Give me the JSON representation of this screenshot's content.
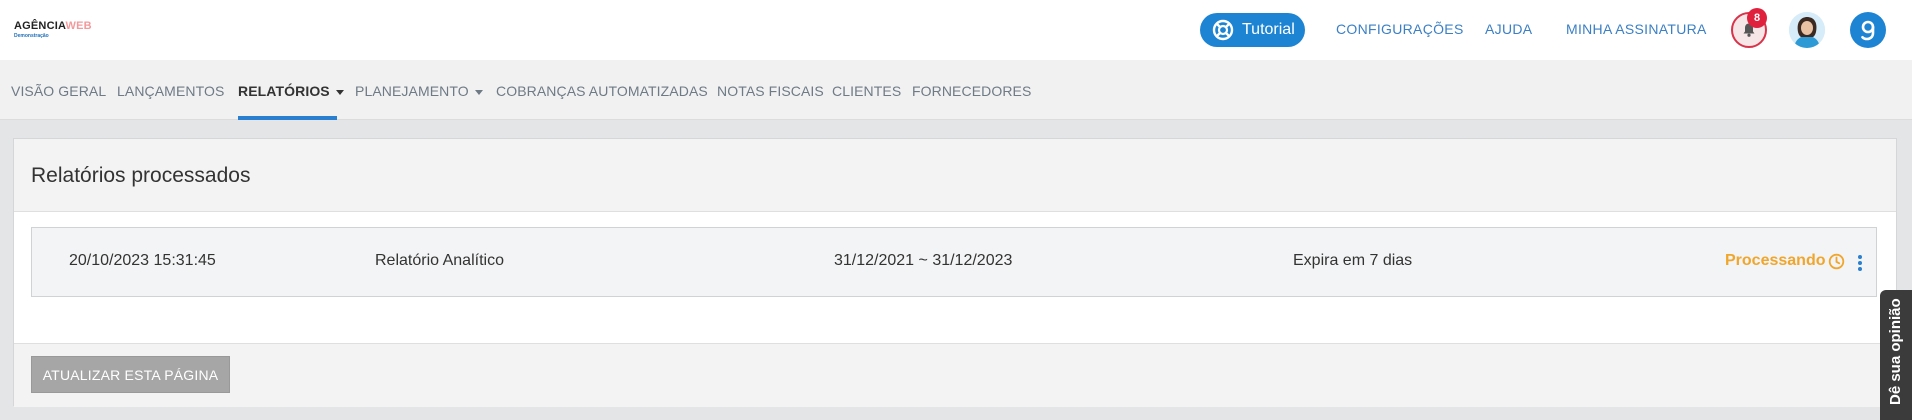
{
  "brand": {
    "logo_main": "AGÊNCIA",
    "logo_accent": "WEB",
    "logo_sub": "Demonstração"
  },
  "header": {
    "tutorial_label": "Tutorial",
    "links": [
      "CONFIGURAÇÕES",
      "AJUDA",
      "MINHA ASSINATURA"
    ],
    "notification_count": "8"
  },
  "nav": {
    "items": [
      "VISÃO GERAL",
      "LANÇAMENTOS",
      "RELATÓRIOS",
      "PLANEJAMENTO",
      "COBRANÇAS AUTOMATIZADAS",
      "NOTAS FISCAIS",
      "CLIENTES",
      "FORNECEDORES"
    ],
    "active": "RELATÓRIOS"
  },
  "panel": {
    "title": "Relatórios processados",
    "rows": [
      {
        "date": "20/10/2023 15:31:45",
        "name": "Relatório Analítico",
        "period": "31/12/2021 ~ 31/12/2023",
        "expiry": "Expira em 7 dias",
        "status": "Processando"
      }
    ],
    "refresh_label": "ATUALIZAR ESTA PÁGINA"
  },
  "feedback": {
    "label": "Dê sua opinião"
  },
  "colors": {
    "primary": "#1d84d4",
    "status_processing": "#f0a62c",
    "badge": "#e0213d"
  }
}
